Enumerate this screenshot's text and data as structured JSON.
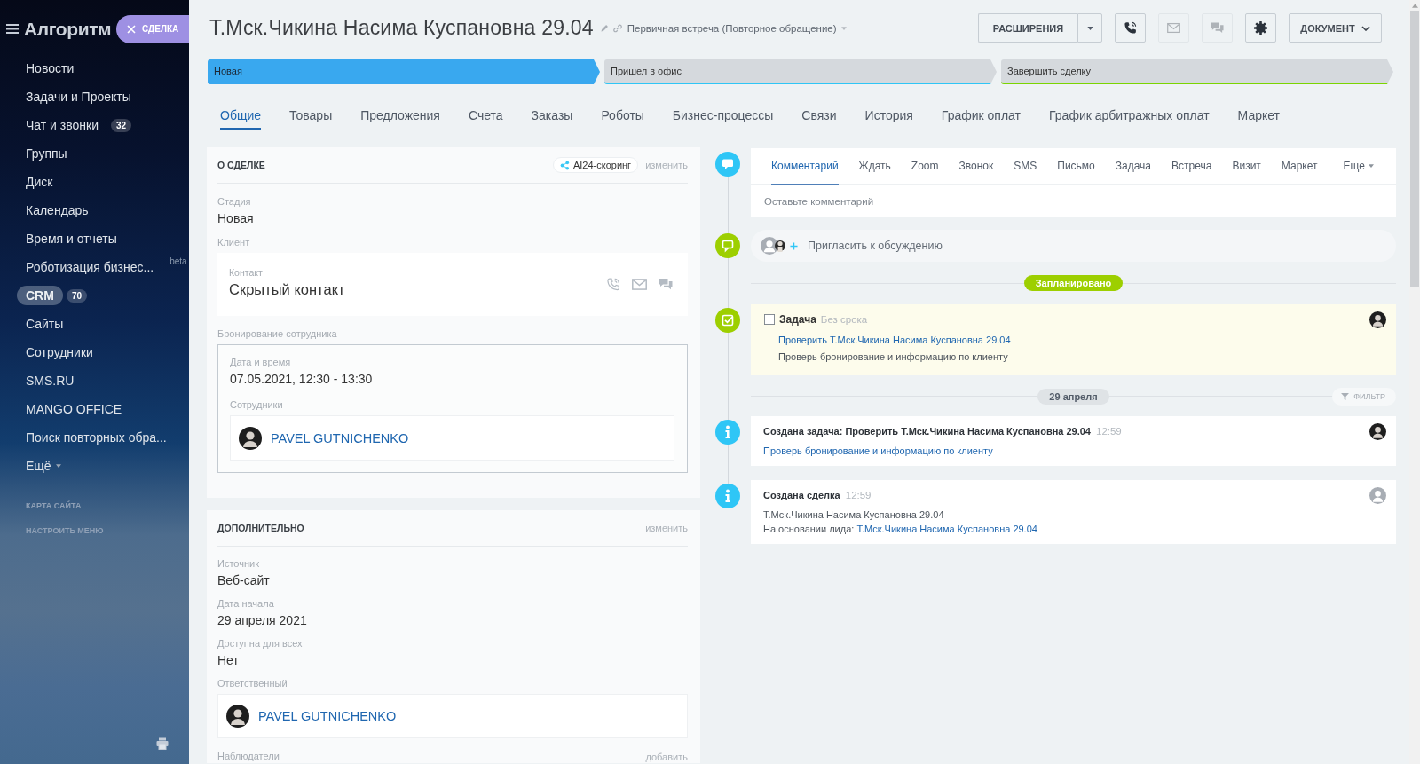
{
  "sidebar": {
    "logo": "Алгоритм",
    "open_tab": "СДЕЛКА",
    "items": [
      {
        "label": "Новости",
        "selected": false
      },
      {
        "label": "Задачи и Проекты",
        "selected": false
      },
      {
        "label": "Чат и звонки",
        "counter": "32",
        "selected": false
      },
      {
        "label": "Группы",
        "selected": false
      },
      {
        "label": "Диск",
        "selected": false
      },
      {
        "label": "Календарь",
        "selected": false
      },
      {
        "label": "Время и отчеты",
        "selected": false
      },
      {
        "label": "Роботизация бизнес...",
        "tag": "beta",
        "selected": false
      },
      {
        "label": "CRM",
        "counter": "70",
        "selected": true
      },
      {
        "label": "Сайты",
        "selected": false
      },
      {
        "label": "Сотрудники",
        "selected": false
      },
      {
        "label": "SMS.RU",
        "selected": false
      },
      {
        "label": "MANGO OFFICE",
        "selected": false
      },
      {
        "label": "Поиск повторных обра...",
        "selected": false
      }
    ],
    "more": "Ещё",
    "links": [
      "КАРТА САЙТА",
      "НАСТРОИТЬ МЕНЮ"
    ]
  },
  "header": {
    "title": "Т.Мск.Чикина Насима Куспановна 29.04",
    "category": "Первичная встреча (Повторное обращение)",
    "extensions": "РАСШИРЕНИЯ",
    "call_button": {
      "disabled": false
    },
    "email_button": {
      "disabled": true
    },
    "chat_button": {
      "disabled": true
    },
    "document": "ДОКУМЕНТ"
  },
  "stages": [
    {
      "label": "Новая",
      "color": "#39a8ef",
      "selected": true
    },
    {
      "label": "Пришел в офис",
      "color": "#2fc6f6",
      "selected": false
    },
    {
      "label": "Завершить сделку",
      "color": "#7bd500",
      "selected": false
    }
  ],
  "tabs": [
    {
      "label": "Общие",
      "selected": true
    },
    {
      "label": "Товары",
      "selected": false
    },
    {
      "label": "Предложения",
      "selected": false
    },
    {
      "label": "Счета",
      "selected": false
    },
    {
      "label": "Заказы",
      "selected": false
    },
    {
      "label": "Роботы",
      "selected": false
    },
    {
      "label": "Бизнес-процессы",
      "selected": false
    },
    {
      "label": "Связи",
      "selected": false
    },
    {
      "label": "История",
      "selected": false
    },
    {
      "label": "График оплат",
      "selected": false
    },
    {
      "label": "График арбитражных оплат",
      "selected": false
    },
    {
      "label": "Маркет",
      "selected": false
    }
  ],
  "about": {
    "title": "О СДЕЛКЕ",
    "scoring": "AI24-скоринг",
    "edit": "изменить",
    "stage": {
      "label": "Стадия",
      "value": "Новая"
    },
    "client": {
      "label": "Клиент",
      "contact_label": "Контакт",
      "contact_name": "Скрытый контакт"
    },
    "booking": {
      "label": "Бронирование сотрудника",
      "datetime_label": "Дата и время",
      "datetime": "07.05.2021, 12:30 - 13:30",
      "employees_label": "Сотрудники",
      "employee": "PAVEL GUTNICHENKO"
    }
  },
  "additional": {
    "title": "ДОПОЛНИТЕЛЬНО",
    "edit": "изменить",
    "fields": [
      {
        "label": "Источник",
        "value": "Веб-сайт"
      },
      {
        "label": "Дата начала",
        "value": "29 апреля 2021"
      },
      {
        "label": "Доступна для всех",
        "value": "Нет"
      }
    ],
    "responsible": {
      "label": "Ответственный",
      "name": "PAVEL GUTNICHENKO"
    },
    "observers": {
      "label": "Наблюдатели",
      "action": "добавить"
    }
  },
  "activity": {
    "tabs": [
      {
        "label": "Комментарий",
        "selected": true
      },
      {
        "label": "Ждать",
        "selected": false
      },
      {
        "label": "Zoom",
        "selected": false
      },
      {
        "label": "Звонок",
        "selected": false
      },
      {
        "label": "SMS",
        "selected": false
      },
      {
        "label": "Письмо",
        "selected": false
      },
      {
        "label": "Задача",
        "selected": false
      },
      {
        "label": "Встреча",
        "selected": false
      },
      {
        "label": "Визит",
        "selected": false
      },
      {
        "label": "Маркет",
        "selected": false
      }
    ],
    "more": "Еще",
    "placeholder": "Оставьте комментарий"
  },
  "invite": {
    "label": "Пригласить к обсуждению"
  },
  "planned": {
    "label": "Запланировано",
    "task": {
      "checked": false,
      "title": "Задача",
      "deadline": "Без срока",
      "link": "Проверить Т.Мск.Чикина Насима Куспановна 29.04",
      "description": "Проверь бронирование и информацию по клиенту"
    }
  },
  "history": {
    "date": "29 апреля",
    "filter": "ФИЛЬТР",
    "events": [
      {
        "kind": "task",
        "photo": true,
        "title": "Создана задача: Проверить Т.Мск.Чикина Насима Куспановна 29.04",
        "time": "12:59",
        "link": "Проверь бронирование и информацию по клиенту"
      },
      {
        "kind": "deal",
        "photo": false,
        "title": "Создана сделка",
        "time": "12:59",
        "text": "Т.Мск.Чикина Насима Куспановна 29.04",
        "basis_label": "На основании лида:",
        "basis_link": "Т.Мск.Чикина Насима Куспановна 29.04"
      }
    ]
  }
}
